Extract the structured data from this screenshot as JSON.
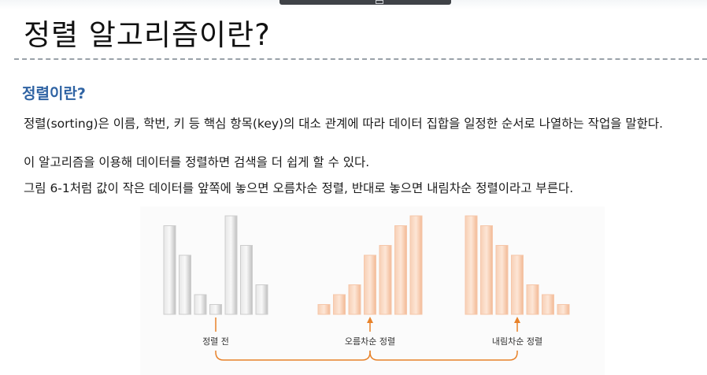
{
  "window": {
    "title": "정렬 알고리즘이란?"
  },
  "section": {
    "heading": "정렬이란?"
  },
  "paragraphs": [
    "정렬(sorting)은 이름, 학번, 키 등 핵심 항목(key)의 대소 관계에 따라 데이터 집합을 일정한 순서로 나열하는 작업을 말한다.",
    "이 알고리즘을 이용해 데이터를 정렬하면 검색을 더 쉽게 할 수 있다.",
    "그림 6-1처럼 값이 작은 데이터를 앞쪽에 놓으면 오름차순 정렬, 반대로 놓으면 내림차순 정렬이라고 부른다."
  ],
  "figure": {
    "colors": {
      "gray_bar": "#cdcdcd",
      "orange_bar": "#f6c7aa",
      "arrow": "#e8822a"
    },
    "groups": [
      {
        "label": "정렬 전",
        "values": [
          9,
          6,
          2,
          1,
          10,
          7,
          3
        ],
        "color": "gray",
        "arrow_index": 3
      },
      {
        "label": "오름차순 정렬",
        "values": [
          1,
          2,
          3,
          6,
          7,
          9,
          10
        ],
        "color": "orange",
        "arrow_index": 3
      },
      {
        "label": "내림차순 정렬",
        "values": [
          10,
          9,
          7,
          6,
          3,
          2,
          1
        ],
        "color": "orange",
        "arrow_index": 3
      }
    ]
  }
}
